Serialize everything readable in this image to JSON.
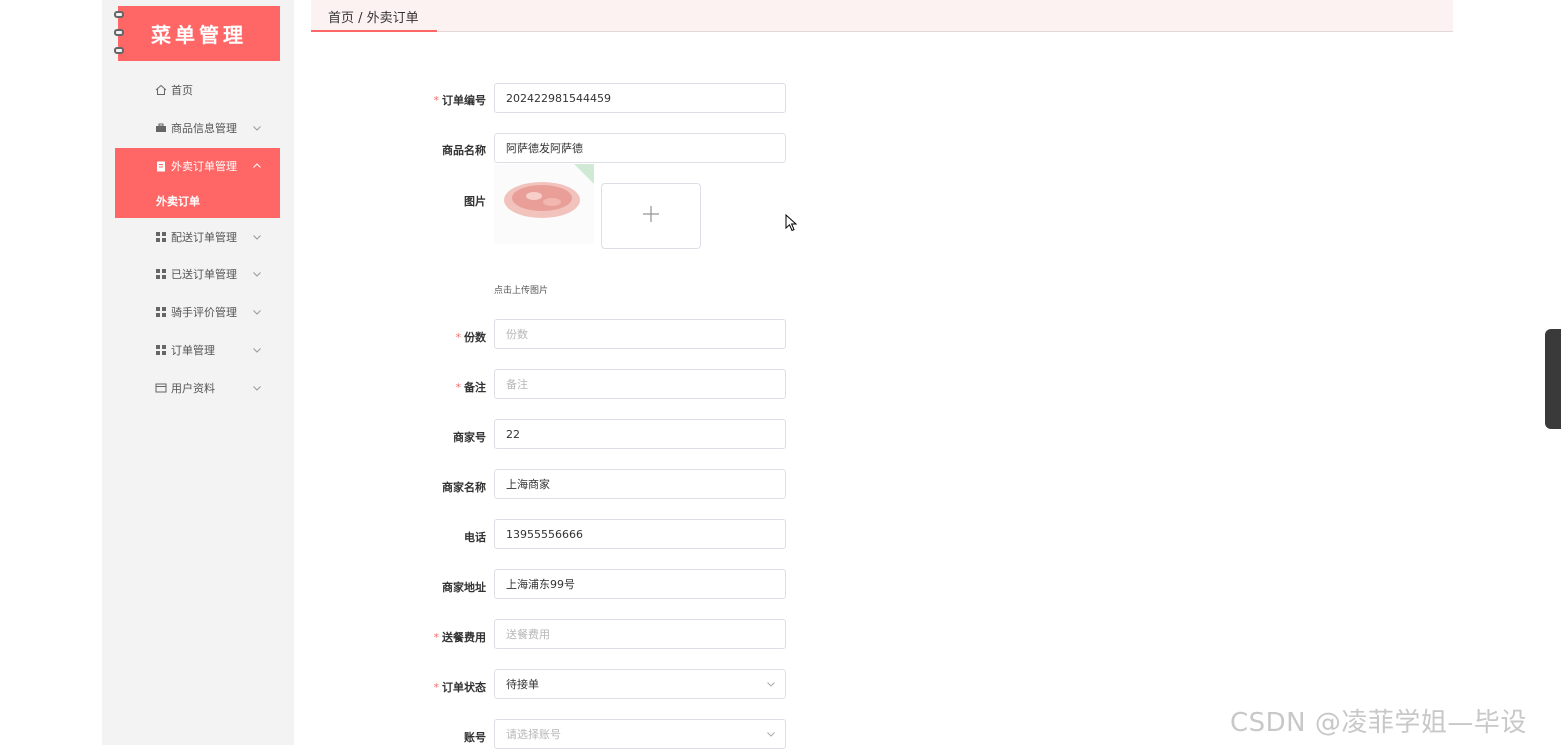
{
  "app": {
    "logo_text": "菜单管理"
  },
  "sidebar": {
    "items": [
      {
        "label": "首页",
        "icon": "home-icon",
        "has_chevron": false
      },
      {
        "label": "商品信息管理",
        "icon": "briefcase-icon",
        "has_chevron": true
      },
      {
        "label": "外卖订单管理",
        "icon": "clipboard-icon",
        "has_chevron": true,
        "active": true,
        "expanded": true
      },
      {
        "label": "配送订单管理",
        "icon": "grid-icon",
        "has_chevron": true
      },
      {
        "label": "已送订单管理",
        "icon": "grid-icon",
        "has_chevron": true
      },
      {
        "label": "骑手评价管理",
        "icon": "grid-icon",
        "has_chevron": true
      },
      {
        "label": "订单管理",
        "icon": "grid-icon",
        "has_chevron": true
      },
      {
        "label": "用户资料",
        "icon": "card-icon",
        "has_chevron": true
      }
    ],
    "submenu": {
      "label": "外卖订单"
    }
  },
  "header": {
    "breadcrumb": "首页 / 外卖订单"
  },
  "form": {
    "order_no": {
      "label": "订单编号",
      "value": "202422981544459"
    },
    "product_name": {
      "label": "商品名称",
      "value": "阿萨德发阿萨德"
    },
    "image": {
      "label": "图片",
      "upload_hint": "点击上传图片"
    },
    "quantity": {
      "label": "份数",
      "placeholder": "份数"
    },
    "remark": {
      "label": "备注",
      "placeholder": "备注"
    },
    "merchant_no": {
      "label": "商家号",
      "value": "22"
    },
    "merchant_name": {
      "label": "商家名称",
      "value": "上海商家"
    },
    "phone": {
      "label": "电话",
      "value": "13955556666"
    },
    "merchant_address": {
      "label": "商家地址",
      "value": "上海浦东99号"
    },
    "delivery_fee": {
      "label": "送餐费用",
      "placeholder": "送餐费用"
    },
    "order_status": {
      "label": "订单状态",
      "value": "待接单"
    },
    "account": {
      "label": "账号",
      "placeholder": "请选择账号"
    }
  },
  "watermark": "CSDN @凌菲学姐—毕设",
  "colors": {
    "accent": "#ff6666",
    "required": "#f56c6c",
    "sidebar_bg": "#f3f3f3"
  }
}
